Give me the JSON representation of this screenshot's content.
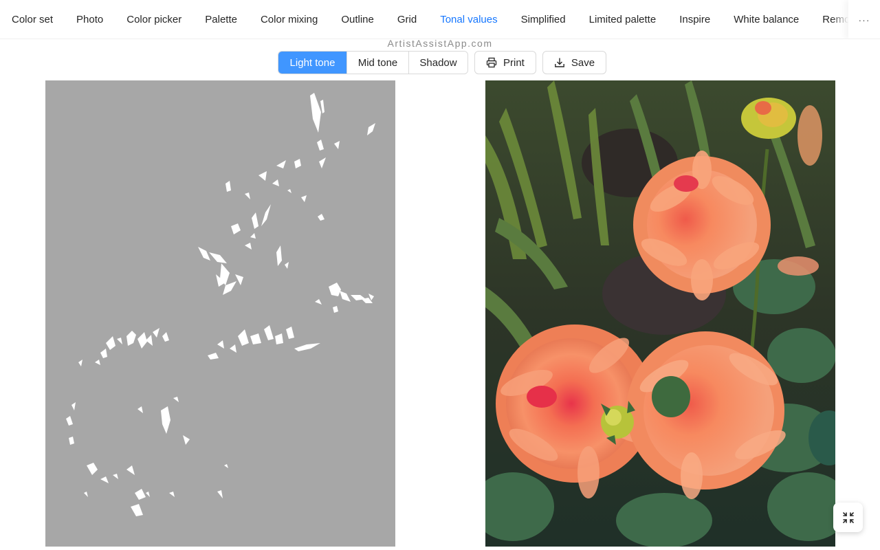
{
  "tabs": [
    {
      "label": "Color set"
    },
    {
      "label": "Photo"
    },
    {
      "label": "Color picker"
    },
    {
      "label": "Palette"
    },
    {
      "label": "Color mixing"
    },
    {
      "label": "Outline"
    },
    {
      "label": "Grid"
    },
    {
      "label": "Tonal values",
      "active": true
    },
    {
      "label": "Simplified"
    },
    {
      "label": "Limited palette"
    },
    {
      "label": "Inspire"
    },
    {
      "label": "White balance"
    },
    {
      "label": "Remove"
    }
  ],
  "more_label": "···",
  "watermark": "ArtistAssistApp.com",
  "tone_modes": [
    {
      "label": "Light tone",
      "active": true
    },
    {
      "label": "Mid tone"
    },
    {
      "label": "Shadow"
    }
  ],
  "actions": {
    "print_label": "Print",
    "save_label": "Save"
  },
  "icons": {
    "print": "printer-icon",
    "save": "download-icon",
    "fullscreen": "fullscreen-exit-icon"
  },
  "colors": {
    "accent": "#1677ff",
    "segment_active": "#4096ff",
    "tonal_background": "#a7a7a7"
  }
}
